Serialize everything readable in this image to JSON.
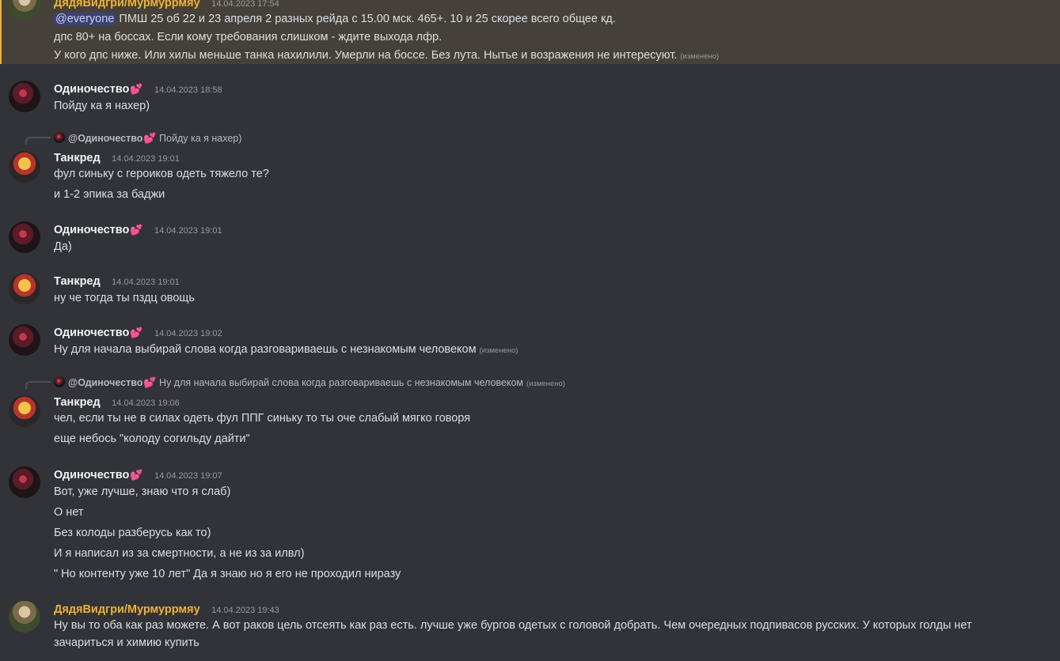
{
  "messages": [
    {
      "author": "ДядяВидгри/Мурмуррмяу",
      "timestamp": "14.04.2023 17:54",
      "mention": "@everyone",
      "lines": [
        "ПМШ 25 об 22 и 23 апреля 2 разных рейда с 15.00 мск. 465+. 10 и 25 скорее всего общее кд.",
        "дпс 80+ на боссах. Если кому требования слишком - ждите выхода лфр.",
        "У кого дпс ниже. Или хилы меньше танка нахилили. Умерли на боссе. Без лута. Нытье и возражения не интересуют."
      ],
      "edited": "(изменено)"
    },
    {
      "author": "Одиночество",
      "heart": "💕",
      "timestamp": "14.04.2023 18:58",
      "lines": [
        "Пойду ка я нахер)"
      ]
    },
    {
      "reply_author": "@Одиночество",
      "reply_text": "Пойду ка я нахер)",
      "author": "Танкред",
      "timestamp": "14.04.2023 19:01",
      "lines": [
        "фул синьку с героиков одеть тяжело те?",
        "и 1-2 эпика за баджи"
      ]
    },
    {
      "author": "Одиночество",
      "heart": "💕",
      "timestamp": "14.04.2023 19:01",
      "lines": [
        "Да)"
      ]
    },
    {
      "author": "Танкред",
      "timestamp": "14.04.2023 19:01",
      "lines": [
        "ну че тогда ты пздц овощь"
      ]
    },
    {
      "author": "Одиночество",
      "heart": "💕",
      "timestamp": "14.04.2023 19:02",
      "lines": [
        "Ну для начала выбирай слова когда разговариваешь с незнакомым человеком"
      ],
      "edited": "(изменено)"
    },
    {
      "reply_author": "@Одиночество",
      "reply_text": "Ну для начала выбирай слова когда разговариваешь с незнакомым человеком",
      "reply_edited": "(изменено)",
      "author": "Танкред",
      "timestamp": "14.04.2023 19:06",
      "lines": [
        "чел, если ты не в силах одеть фул ППГ синьку то ты оче слабый мягко говоря",
        "еще небось \"колоду согильду дайти\""
      ]
    },
    {
      "author": "Одиночество",
      "heart": "💕",
      "timestamp": "14.04.2023 19:07",
      "lines": [
        "Вот, уже лучше, знаю что я слаб)",
        "О нет",
        "Без колоды разберусь как то)",
        "И я написал из за смертности, а не из за илвл)",
        "\" Но контенту уже 10 лет\" Да я знаю но я его не проходил ниразу"
      ]
    },
    {
      "author": "ДядяВидгри/Мурмуррмяу",
      "timestamp": "14.04.2023 19:43",
      "lines": [
        "Ну вы то оба как раз можете. А вот раков цель отсеять как раз есть. лучше уже бургов одетых с головой добрать. Чем очередных подпивасов русских. У которых голды нет",
        "зачариться и химию купить"
      ]
    }
  ],
  "colors": {
    "background": "#313338",
    "highlight": "#45413a",
    "author_gold": "#f0b232",
    "mention_bg": "#3c4270"
  }
}
